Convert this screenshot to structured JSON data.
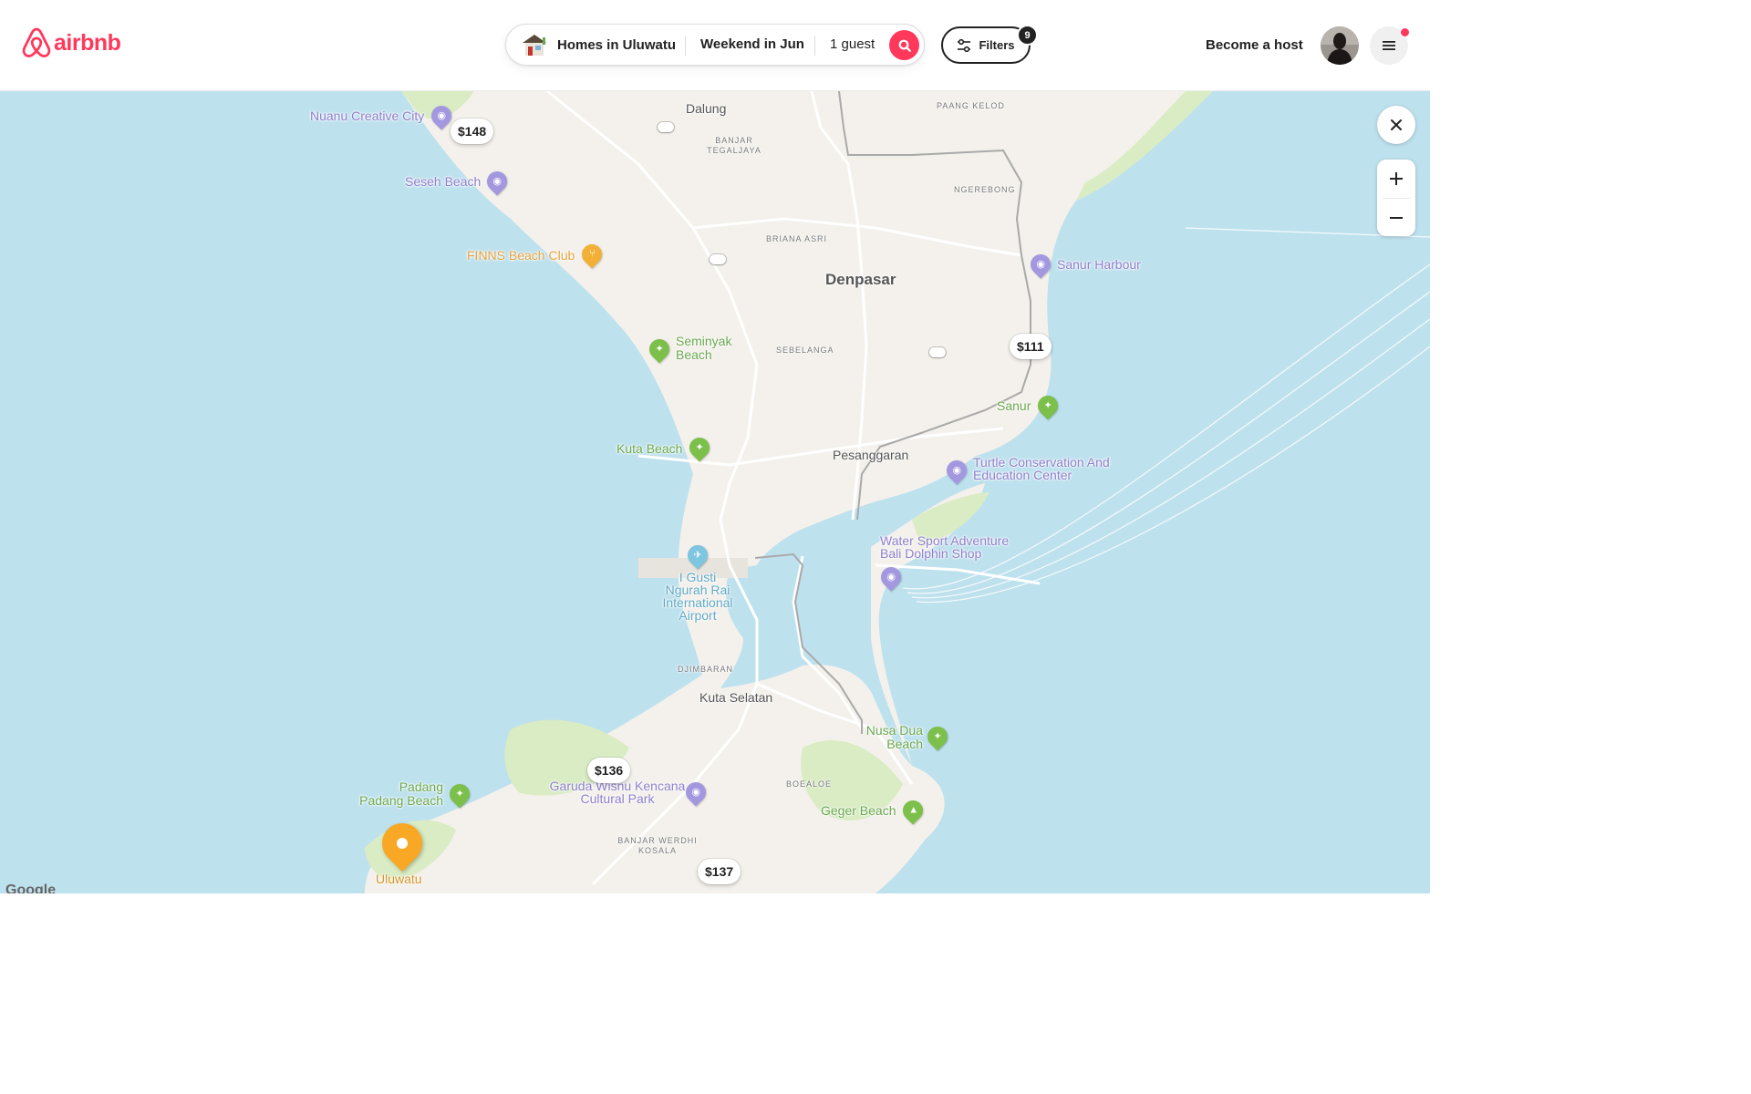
{
  "header": {
    "logo_text": "airbnb",
    "search": {
      "location": "Homes in Uluwatu",
      "dates": "Weekend in Jun",
      "guests": "1 guest",
      "search_icon": "search-icon"
    },
    "filters": {
      "label": "Filters",
      "count": "9"
    },
    "become_host": "Become a host",
    "menu_icon": "hamburger-menu-icon"
  },
  "map": {
    "place_labels": {
      "dalung": "Dalung",
      "banjar_tegaljaya": "BANJAR TEGALJAYA",
      "paang_kelod": "PAANG KELOD",
      "ngerebong": "NGEREBONG",
      "briana_asri": "BRIANA ASRI",
      "denpasar": "Denpasar",
      "sebelanga": "SEBELANGA",
      "pesanggaran": "Pesanggaran",
      "djimbaran": "DJIMBARAN",
      "kuta_selatan": "Kuta Selatan",
      "boealoe": "BOEALOE",
      "banjar_werdhi_kosala": "BANJAR WERDHI KOSALA",
      "uluwatu": "Uluwatu"
    },
    "poi_labels": {
      "nuanu": "Nuanu Creative City",
      "seseh": "Seseh Beach",
      "finns": "FINNS Beach Club",
      "seminyak": "Seminyak Beach",
      "kuta_beach": "Kuta Beach",
      "sanur_harbour": "Sanur Harbour",
      "sanur": "Sanur",
      "turtle": "Turtle Conservation And Education Center",
      "water_sport": "Water Sport Adventure Bali Dolphin Shop",
      "airport": "I Gusti Ngurah Rai International Airport",
      "nusa_dua": "Nusa Dua Beach",
      "garuda": "Garuda Wisnu Kencana Cultural Park",
      "padang": "Padang Padang Beach",
      "geger": "Geger Beach"
    },
    "prices": {
      "p148": "$148",
      "p111": "$111",
      "p136": "$136",
      "p137": "$137"
    },
    "attribution": "Google"
  },
  "controls": {
    "close_icon": "close-icon",
    "zoom_in_icon": "plus-icon",
    "zoom_out_icon": "minus-icon"
  },
  "colors": {
    "brand": "#ff385c",
    "water": "#bee1ee",
    "land": "#f4f1ec",
    "park": "#d9ecc4",
    "selected_pin": "#f9a825"
  }
}
